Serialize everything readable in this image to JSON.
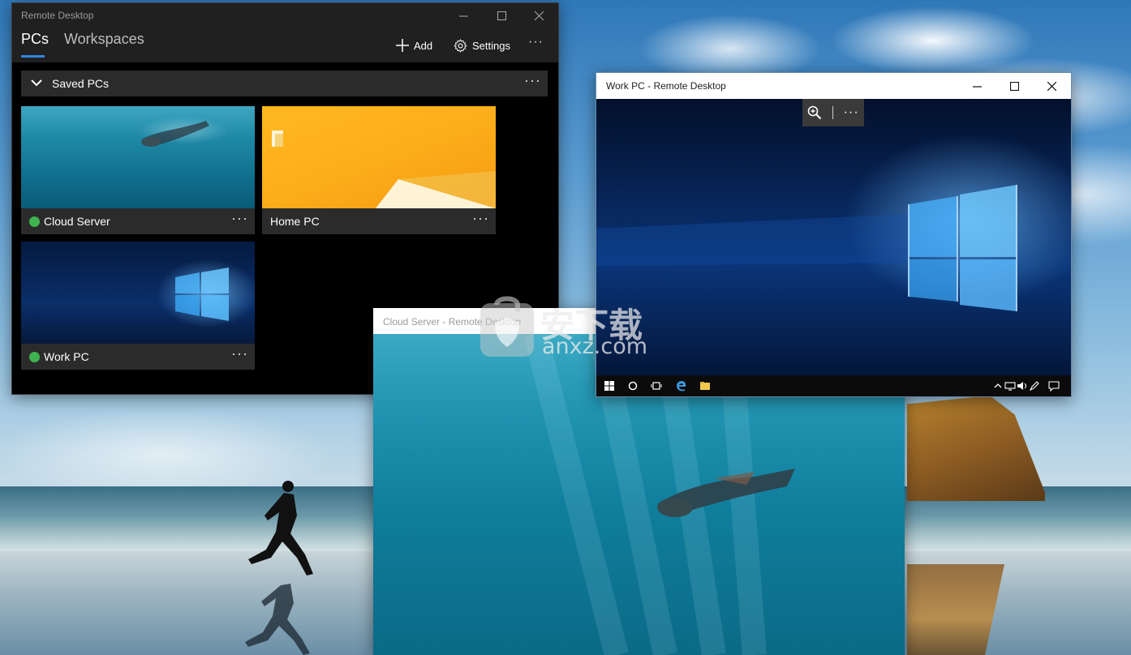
{
  "main_window": {
    "title": "Remote Desktop",
    "tabs": [
      {
        "label": "PCs",
        "active": true
      },
      {
        "label": "Workspaces",
        "active": false
      }
    ],
    "actions": {
      "add": "Add",
      "settings": "Settings"
    },
    "group": {
      "label": "Saved PCs"
    },
    "pcs": [
      {
        "name": "Cloud Server",
        "status": "online",
        "thumbnail": "underwater-wallpaper"
      },
      {
        "name": "Home PC",
        "thumbnail": "windows-8-wallpaper"
      },
      {
        "name": "Work PC",
        "status": "online",
        "thumbnail": "windows-10-wallpaper"
      }
    ]
  },
  "work_window": {
    "title": "Work PC - Remote Desktop",
    "taskbar_icons": [
      "windows-start-icon",
      "cortana-icon",
      "task-view-icon",
      "edge-icon",
      "file-explorer-icon"
    ],
    "tray_icons": [
      "chevron-up-icon",
      "network-icon",
      "volume-icon",
      "pen-icon",
      "action-center-icon"
    ]
  },
  "cloud_window": {
    "title": "Cloud Server - Remote Desktop"
  },
  "watermark": {
    "text_cn": "安下载",
    "text_en": "anxz.com"
  },
  "colors": {
    "accent": "#2e86de",
    "status_online": "#3fb34f",
    "dark_bg": "#000000",
    "dark_chrome": "#202020",
    "tile_bg": "#2b2b2b"
  }
}
